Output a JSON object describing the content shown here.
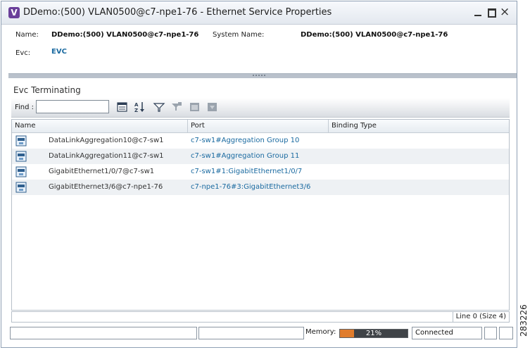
{
  "window": {
    "title": "DDemo:(500) VLAN0500@c7-npe1-76 - Ethernet Service Properties",
    "app_icon": "V",
    "controls": {
      "minimize": "minimize-icon",
      "maximize": "maximize-icon",
      "close": "×"
    }
  },
  "properties": {
    "name_label": "Name:",
    "name_value": "DDemo:(500) VLAN0500@c7-npe1-76",
    "system_name_label": "System Name:",
    "system_name_value": "DDemo:(500) VLAN0500@c7-npe1-76",
    "evc_label": "Evc:",
    "evc_value": "EVC"
  },
  "section": {
    "title": "Evc Terminating"
  },
  "toolbar": {
    "find_label": "Find :",
    "find_value": "",
    "icons": [
      "table-properties-icon",
      "sort-az-icon",
      "filter-icon",
      "clear-filter-icon",
      "export-icon",
      "print-icon"
    ]
  },
  "table": {
    "columns": [
      "Name",
      "Port",
      "Binding Type"
    ],
    "rows": [
      {
        "name": "DataLinkAggregation10@c7-sw1",
        "port": "c7-sw1#Aggregation Group 10",
        "binding": ""
      },
      {
        "name": "DataLinkAggregation11@c7-sw1",
        "port": "c7-sw1#Aggregation Group 11",
        "binding": ""
      },
      {
        "name": "GigabitEthernet1/0/7@c7-sw1",
        "port": "c7-sw1#1:GigabitEthernet1/0/7",
        "binding": ""
      },
      {
        "name": "GigabitEthernet3/6@c7-npe1-76",
        "port": "c7-npe1-76#3:GigabitEthernet3/6",
        "binding": ""
      }
    ],
    "row_count_text": "Line 0 (Size 4)"
  },
  "statusbar": {
    "memory_label": "Memory:",
    "memory_percent": 21,
    "memory_text": "21%",
    "connection_status": "Connected"
  },
  "colors": {
    "link": "#1a6aa0",
    "memory_fill": "#e07c2c",
    "app_icon": "#6a3f9a"
  },
  "figure_id": "283226"
}
